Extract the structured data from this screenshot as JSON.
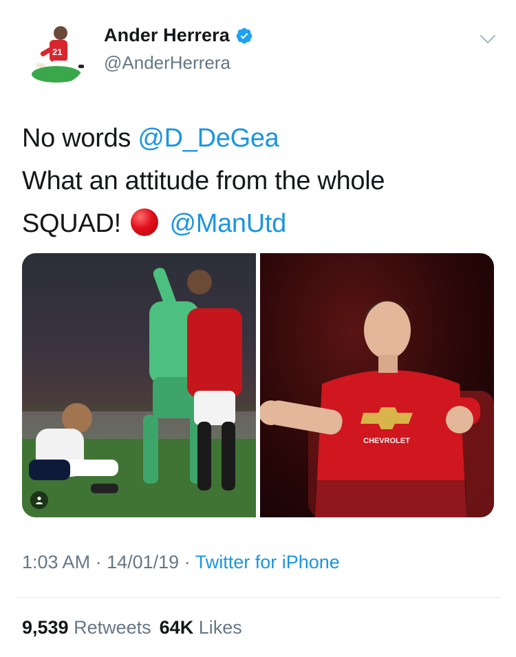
{
  "tweet": {
    "author": {
      "display_name": "Ander Herrera",
      "handle": "@AnderHerrera",
      "verified": true,
      "avatar_icon": "player-cartoon-avatar"
    },
    "text": {
      "line1_prefix": "No words ",
      "mention1": "@D_DeGea",
      "line2": "What an attitude from the whole",
      "line3_prefix": "SQUAD!",
      "emoji": "red-circle-emoji",
      "mention2": "@ManUtd"
    },
    "media": [
      {
        "name": "photo-degea-celebration",
        "tag_icon": "user-tag-icon"
      },
      {
        "name": "photo-herrera-fist-pump"
      }
    ],
    "meta": {
      "time": "1:03 AM",
      "sep1": " · ",
      "date": "14/01/19",
      "sep2": " · ",
      "source": "Twitter for iPhone"
    },
    "stats": {
      "retweets_count": "9,539",
      "retweets_label": "Retweets",
      "likes_count": "64K",
      "likes_label": "Likes"
    }
  },
  "colors": {
    "link": "#1b95e0",
    "text": "#14171a",
    "secondary": "#657786",
    "divider": "#e1e8ed"
  }
}
